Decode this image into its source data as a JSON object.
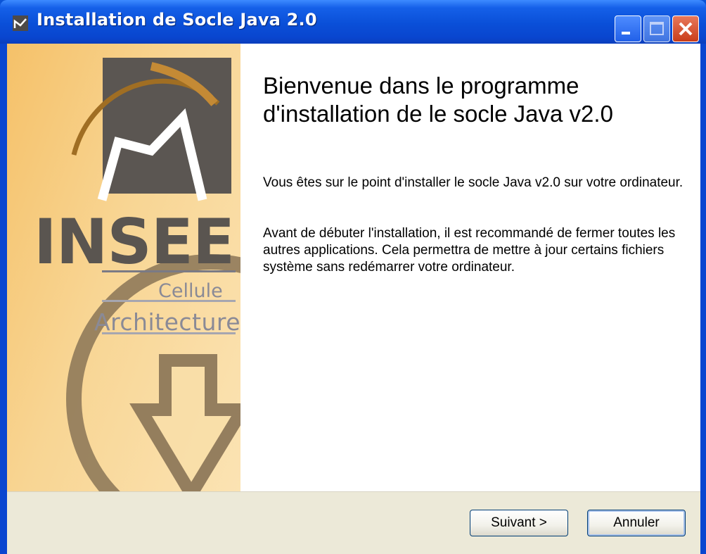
{
  "window": {
    "title": "Installation de Socle Java 2.0"
  },
  "banner": {
    "brand": "INSEE",
    "line1": "Cellule",
    "line2": "Architecture"
  },
  "content": {
    "heading_line1": "Bienvenue dans le programme",
    "heading_line2": "d'installation de le socle Java v2.0",
    "paragraph1": "Vous êtes sur le point d'installer le socle Java v2.0 sur votre ordinateur.",
    "paragraph2": "Avant de débuter l'installation, il est recommandé de fermer toutes les autres applications. Cela permettra de mettre à jour certains fichiers système sans redémarrer votre ordinateur."
  },
  "buttons": {
    "next": "Suivant >",
    "cancel": "Annuler"
  },
  "colors": {
    "titlebar": "#0a4fd8",
    "banner": "#f8d593",
    "footer": "#ece9d8"
  }
}
